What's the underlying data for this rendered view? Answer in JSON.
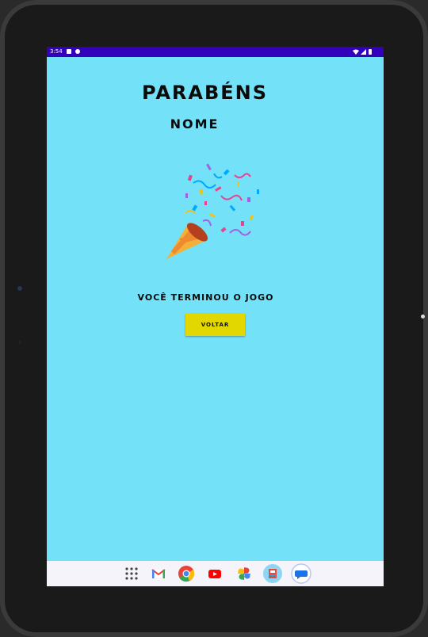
{
  "status_bar": {
    "time": "3:54"
  },
  "content": {
    "title": "PARABÉNS",
    "name": "NOME",
    "message": "VOCÊ TERMINOU O JOGO",
    "back_button": "VOLTAR"
  },
  "dock": {
    "icons": [
      "app-drawer-icon",
      "gmail-icon",
      "chrome-icon",
      "youtube-icon",
      "photos-icon",
      "books-icon",
      "messages-icon"
    ]
  },
  "colors": {
    "background": "#73e1f7",
    "status_bar": "#3300bb",
    "button": "#e2d800"
  }
}
